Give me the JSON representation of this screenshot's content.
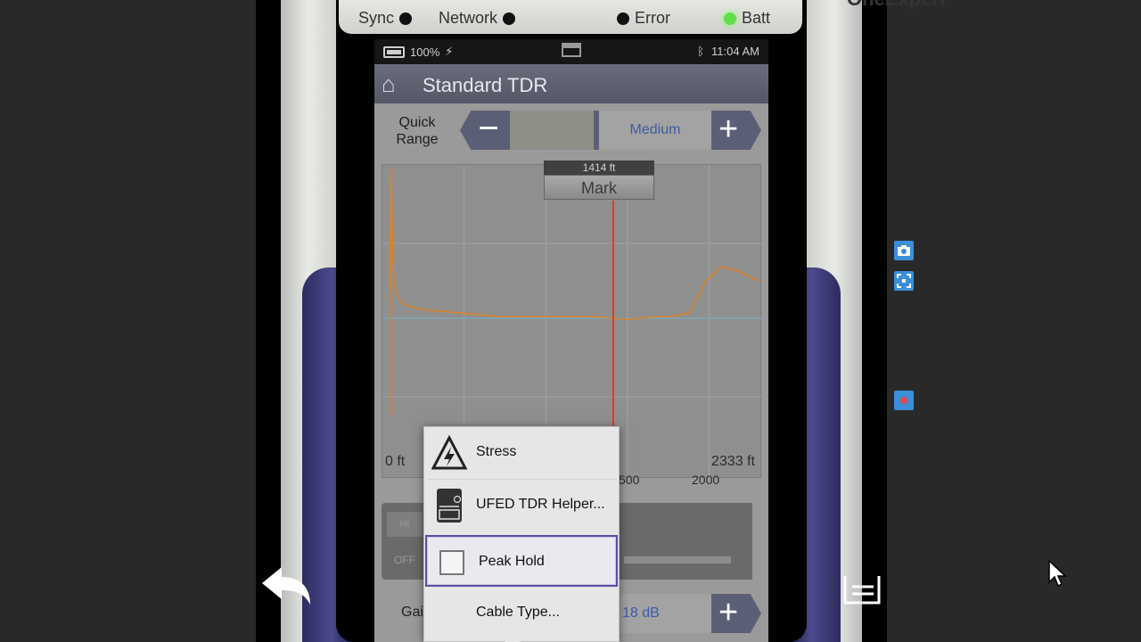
{
  "led_strip": {
    "brand": "OneExpert",
    "indicators": [
      {
        "label": "Sync",
        "state": "off"
      },
      {
        "label": "Network",
        "state": "off"
      },
      {
        "label": "Error",
        "state": "off"
      },
      {
        "label": "Batt",
        "state": "on",
        "color": "#5fe04a"
      }
    ]
  },
  "status_bar": {
    "battery": "100%",
    "time": "11:04 AM"
  },
  "header": {
    "title": "Standard TDR"
  },
  "quick_range": {
    "label": "Quick Range",
    "value": "Medium"
  },
  "chart": {
    "marker_distance": "1414 ft",
    "marker_label": "Mark",
    "left_label": "0 ft",
    "right_label": "2333 ft",
    "ticks_visible": [
      "500",
      "2000"
    ]
  },
  "chart_data": {
    "type": "line",
    "xlim": [
      0,
      2333
    ],
    "x_unit": "ft",
    "marker_x": 1414,
    "grid": true,
    "series": [
      {
        "color": "#d9822b",
        "x": [
          0,
          10,
          20,
          30,
          60,
          100,
          200,
          300,
          500,
          700,
          900,
          1100,
          1300,
          1500,
          1700,
          1800,
          1900,
          2000,
          2100,
          2200,
          2333
        ],
        "y": [
          0.2,
          1.0,
          0.45,
          0.2,
          0.12,
          0.08,
          0.05,
          0.04,
          0.02,
          0.0,
          0.0,
          0.0,
          0.0,
          -0.02,
          0.0,
          0.0,
          0.03,
          0.25,
          0.35,
          0.32,
          0.25
        ]
      }
    ]
  },
  "gain": {
    "label": "Gai",
    "value": "18 dB",
    "toggle_hi": "HI",
    "toggle_off": "OFF"
  },
  "context_menu": {
    "items": [
      {
        "label": "Stress",
        "icon": "warning-triangle-icon"
      },
      {
        "label": "UFED TDR Helper...",
        "icon": "device-icon"
      },
      {
        "label": "Peak Hold",
        "icon": "checkbox-icon",
        "selected": true,
        "checked": false
      },
      {
        "label": "Cable Type...",
        "icon": ""
      }
    ]
  },
  "sidebar_tools": [
    "camera-icon",
    "fullscreen-icon",
    "record-icon"
  ]
}
